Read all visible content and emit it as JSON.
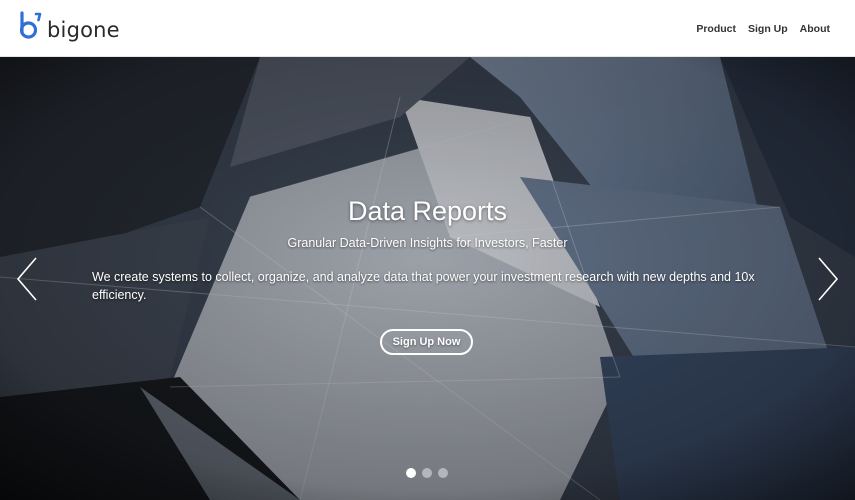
{
  "brand": {
    "name": "bigone",
    "accent_color": "#2f6fd6",
    "logo_icon": "bigone-logo-icon"
  },
  "nav": {
    "links": [
      {
        "label": "Product"
      },
      {
        "label": "Sign Up"
      },
      {
        "label": "About"
      }
    ]
  },
  "hero": {
    "title": "Data Reports",
    "subtitle": "Granular Data-Driven Insights for Investors, Faster",
    "description": "We create systems to collect, organize, and analyze data that power your investment research with new depths and 10x efficiency.",
    "cta_label": "Sign Up Now",
    "prev_icon": "chevron-left-icon",
    "next_icon": "chevron-right-icon",
    "slides_total": 3,
    "active_slide": 1
  }
}
